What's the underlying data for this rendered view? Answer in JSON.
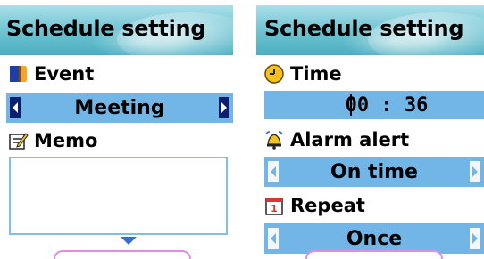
{
  "left_screen": {
    "title": "Schedule setting",
    "event": {
      "label": "Event",
      "icon": "book-icon",
      "value": "Meeting"
    },
    "memo": {
      "label": "Memo",
      "icon": "memo-pencil-icon",
      "text": ""
    }
  },
  "right_screen": {
    "title": "Schedule setting",
    "time": {
      "label": "Time",
      "icon": "clock-icon",
      "value": "00 : 36"
    },
    "alarm": {
      "label": "Alarm alert",
      "icon": "bell-alarm-icon",
      "value": "On time"
    },
    "repeat": {
      "label": "Repeat",
      "icon": "calendar-icon",
      "value": "Once"
    }
  },
  "colors": {
    "title_bar": "#6cc2d1",
    "selector_bg": "#72b6e8",
    "arrow_dark": "#0a1f6e",
    "scroll_arrow": "#2e72d8",
    "softkey_outline": "#e08ee0"
  }
}
